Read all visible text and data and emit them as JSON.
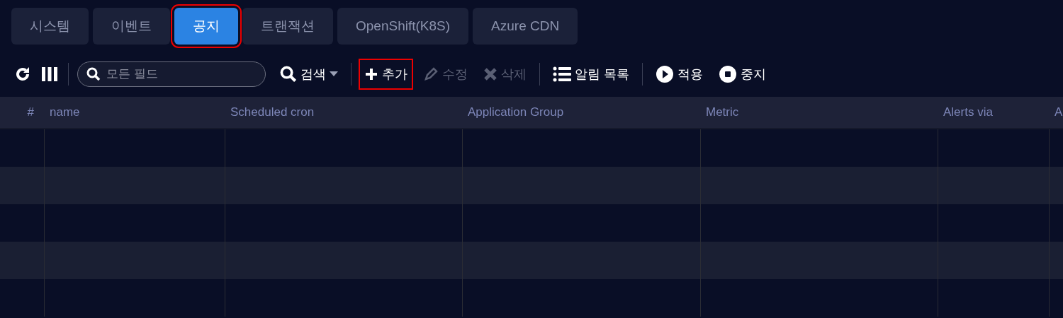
{
  "tabs": [
    {
      "label": "시스템",
      "selected": false,
      "highlighted": false
    },
    {
      "label": "이벤트",
      "selected": false,
      "highlighted": false
    },
    {
      "label": "공지",
      "selected": true,
      "highlighted": true
    },
    {
      "label": "트랜잭션",
      "selected": false,
      "highlighted": false
    },
    {
      "label": "OpenShift(K8S)",
      "selected": false,
      "highlighted": false
    },
    {
      "label": "Azure CDN",
      "selected": false,
      "highlighted": false
    }
  ],
  "toolbar": {
    "search": {
      "placeholder": "모든 필드"
    },
    "search_button": "검색",
    "actions": [
      {
        "kind": "add",
        "label": "추가",
        "disabled": false,
        "highlighted": true
      },
      {
        "kind": "edit",
        "label": "수정",
        "disabled": true,
        "highlighted": false
      },
      {
        "kind": "delete",
        "label": "삭제",
        "disabled": true,
        "highlighted": false
      },
      {
        "kind": "list",
        "label": "알림 목록",
        "disabled": false,
        "highlighted": false
      },
      {
        "kind": "play",
        "label": "적용",
        "disabled": false,
        "highlighted": false
      },
      {
        "kind": "stop",
        "label": "중지",
        "disabled": false,
        "highlighted": false
      }
    ]
  },
  "table": {
    "columns": [
      "#",
      "name",
      "Scheduled cron",
      "Application Group",
      "Metric",
      "Alerts via",
      "A"
    ]
  }
}
